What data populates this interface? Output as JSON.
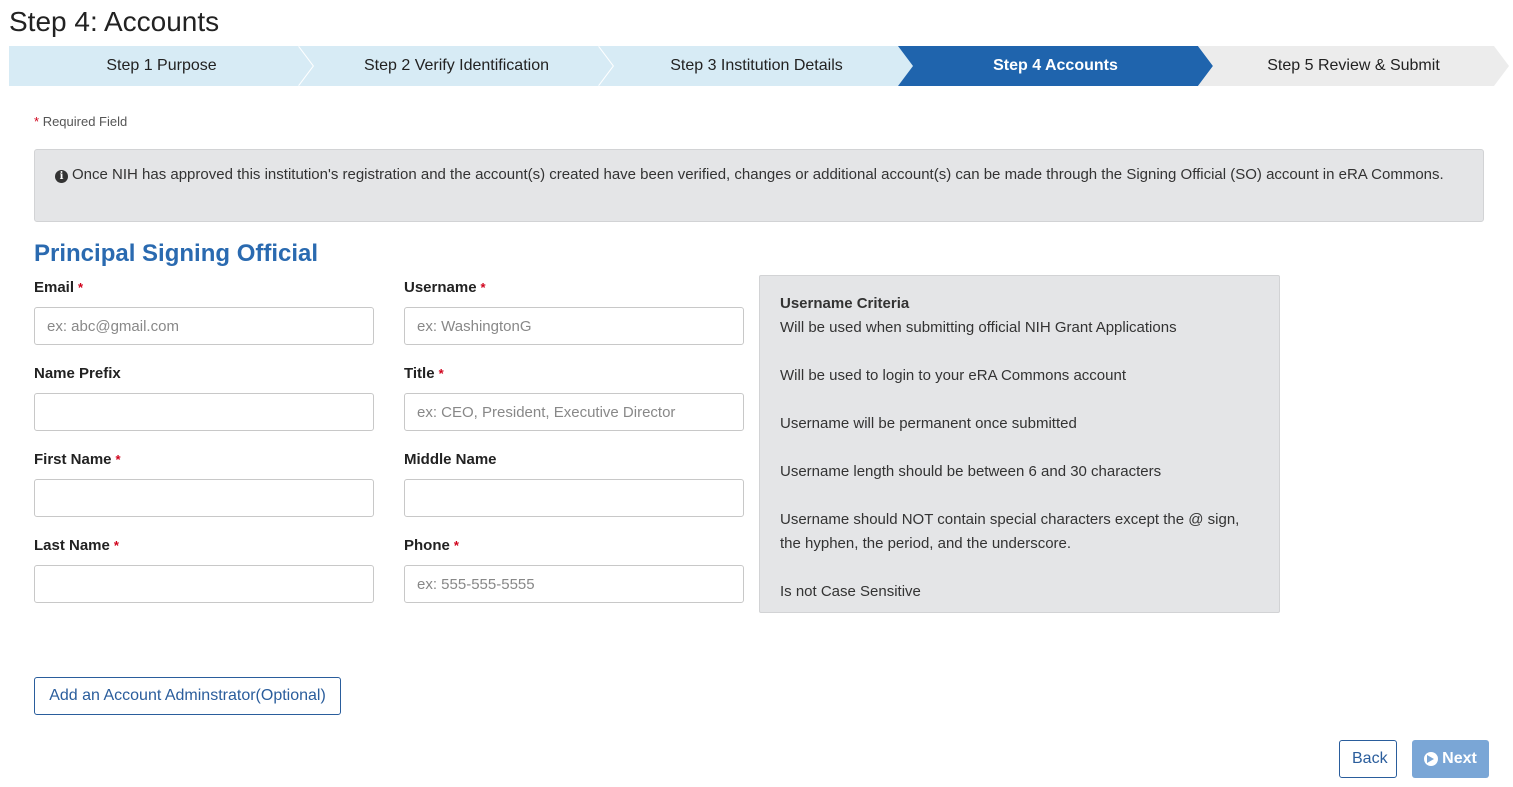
{
  "page": {
    "title": "Step 4: Accounts"
  },
  "steps": [
    {
      "label": "Step 1 Purpose",
      "state": "done"
    },
    {
      "label": "Step 2 Verify Identification",
      "state": "done"
    },
    {
      "label": "Step 3 Institution Details",
      "state": "done"
    },
    {
      "label": "Step 4 Accounts",
      "state": "active"
    },
    {
      "label": "Step 5 Review & Submit",
      "state": "upcoming"
    }
  ],
  "colors": {
    "step_done": "#d7ebf5",
    "step_active": "#1f64ad",
    "step_upcoming": "#ececec",
    "accent": "#2a6ab0",
    "required": "#d0021b"
  },
  "required_note": {
    "star": "*",
    "text": "Required Field"
  },
  "info": {
    "icon": "info-circle-icon",
    "text": "Once NIH has approved this institution's registration and the account(s) created have been verified, changes or additional account(s) can be made through the Signing Official (SO) account in eRA Commons."
  },
  "section": {
    "title": "Principal Signing Official"
  },
  "fields": {
    "email": {
      "label": "Email",
      "required": true,
      "placeholder": "ex: abc@gmail.com",
      "value": ""
    },
    "username": {
      "label": "Username",
      "required": true,
      "placeholder": "ex: WashingtonG",
      "value": ""
    },
    "name_prefix": {
      "label": "Name Prefix",
      "required": false,
      "placeholder": "",
      "value": ""
    },
    "title": {
      "label": "Title",
      "required": true,
      "placeholder": "ex: CEO, President, Executive Director",
      "value": ""
    },
    "first_name": {
      "label": "First Name",
      "required": true,
      "placeholder": "",
      "value": ""
    },
    "middle_name": {
      "label": "Middle Name",
      "required": false,
      "placeholder": "",
      "value": ""
    },
    "last_name": {
      "label": "Last Name",
      "required": true,
      "placeholder": "",
      "value": ""
    },
    "phone": {
      "label": "Phone",
      "required": true,
      "placeholder": "ex: 555-555-5555",
      "value": ""
    }
  },
  "criteria": {
    "title": "Username Criteria",
    "items": [
      "Will be used when submitting official NIH Grant Applications",
      "Will be used to login to your eRA Commons account",
      "Username will be permanent once submitted",
      "Username length should be between 6 and 30 characters",
      "Username should NOT contain special characters except the @ sign, the hyphen, the period, and the underscore.",
      "Is not Case Sensitive"
    ]
  },
  "buttons": {
    "add_admin": "Add an Account Adminstrator(Optional)",
    "back": "Back",
    "next": "Next"
  }
}
